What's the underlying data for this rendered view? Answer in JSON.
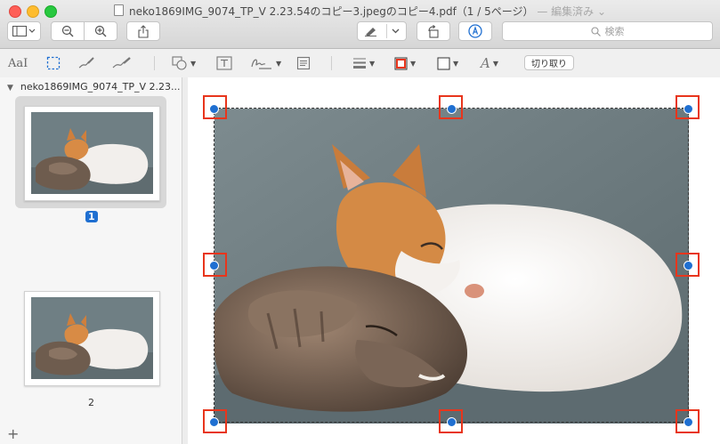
{
  "window": {
    "title": "neko1869IMG_9074_TP_V 2.23.54のコピー3.jpegのコピー4.pdf（1 / 5ページ）",
    "edited_status": "— 編集済み ⌄"
  },
  "toolbar": {
    "sidebar_icon": "sidebar-icon",
    "zoom_out_icon": "zoom-out-icon",
    "zoom_in_icon": "zoom-in-icon",
    "share_icon": "share-icon",
    "highlight_icon": "highlighter-icon",
    "rotate_icon": "rotate-icon",
    "markup_icon": "markup-pen-icon",
    "search_placeholder": "検索"
  },
  "markup_toolbar": {
    "text_size_label": "AaI",
    "crop_label": "切り取り"
  },
  "sidebar": {
    "file_label": "neko1869IMG_9074_TP_V 2.23...",
    "pages": [
      {
        "number": "1",
        "selected": true
      },
      {
        "number": "2",
        "selected": false
      }
    ],
    "add_label": "+"
  },
  "colors": {
    "selection_accent": "#1f6fd1",
    "handle_highlight": "#e8351c"
  }
}
